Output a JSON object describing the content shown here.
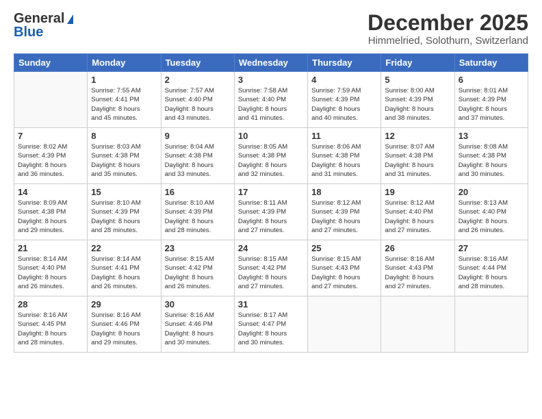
{
  "logo": {
    "line1": "General",
    "line2": "Blue"
  },
  "title": "December 2025",
  "location": "Himmelried, Solothurn, Switzerland",
  "days_of_week": [
    "Sunday",
    "Monday",
    "Tuesday",
    "Wednesday",
    "Thursday",
    "Friday",
    "Saturday"
  ],
  "weeks": [
    [
      {
        "day": "",
        "info": ""
      },
      {
        "day": "1",
        "info": "Sunrise: 7:55 AM\nSunset: 4:41 PM\nDaylight: 8 hours\nand 45 minutes."
      },
      {
        "day": "2",
        "info": "Sunrise: 7:57 AM\nSunset: 4:40 PM\nDaylight: 8 hours\nand 43 minutes."
      },
      {
        "day": "3",
        "info": "Sunrise: 7:58 AM\nSunset: 4:40 PM\nDaylight: 8 hours\nand 41 minutes."
      },
      {
        "day": "4",
        "info": "Sunrise: 7:59 AM\nSunset: 4:39 PM\nDaylight: 8 hours\nand 40 minutes."
      },
      {
        "day": "5",
        "info": "Sunrise: 8:00 AM\nSunset: 4:39 PM\nDaylight: 8 hours\nand 38 minutes."
      },
      {
        "day": "6",
        "info": "Sunrise: 8:01 AM\nSunset: 4:39 PM\nDaylight: 8 hours\nand 37 minutes."
      }
    ],
    [
      {
        "day": "7",
        "info": "Sunrise: 8:02 AM\nSunset: 4:39 PM\nDaylight: 8 hours\nand 36 minutes."
      },
      {
        "day": "8",
        "info": "Sunrise: 8:03 AM\nSunset: 4:38 PM\nDaylight: 8 hours\nand 35 minutes."
      },
      {
        "day": "9",
        "info": "Sunrise: 8:04 AM\nSunset: 4:38 PM\nDaylight: 8 hours\nand 33 minutes."
      },
      {
        "day": "10",
        "info": "Sunrise: 8:05 AM\nSunset: 4:38 PM\nDaylight: 8 hours\nand 32 minutes."
      },
      {
        "day": "11",
        "info": "Sunrise: 8:06 AM\nSunset: 4:38 PM\nDaylight: 8 hours\nand 31 minutes."
      },
      {
        "day": "12",
        "info": "Sunrise: 8:07 AM\nSunset: 4:38 PM\nDaylight: 8 hours\nand 31 minutes."
      },
      {
        "day": "13",
        "info": "Sunrise: 8:08 AM\nSunset: 4:38 PM\nDaylight: 8 hours\nand 30 minutes."
      }
    ],
    [
      {
        "day": "14",
        "info": "Sunrise: 8:09 AM\nSunset: 4:38 PM\nDaylight: 8 hours\nand 29 minutes."
      },
      {
        "day": "15",
        "info": "Sunrise: 8:10 AM\nSunset: 4:39 PM\nDaylight: 8 hours\nand 28 minutes."
      },
      {
        "day": "16",
        "info": "Sunrise: 8:10 AM\nSunset: 4:39 PM\nDaylight: 8 hours\nand 28 minutes."
      },
      {
        "day": "17",
        "info": "Sunrise: 8:11 AM\nSunset: 4:39 PM\nDaylight: 8 hours\nand 27 minutes."
      },
      {
        "day": "18",
        "info": "Sunrise: 8:12 AM\nSunset: 4:39 PM\nDaylight: 8 hours\nand 27 minutes."
      },
      {
        "day": "19",
        "info": "Sunrise: 8:12 AM\nSunset: 4:40 PM\nDaylight: 8 hours\nand 27 minutes."
      },
      {
        "day": "20",
        "info": "Sunrise: 8:13 AM\nSunset: 4:40 PM\nDaylight: 8 hours\nand 26 minutes."
      }
    ],
    [
      {
        "day": "21",
        "info": "Sunrise: 8:14 AM\nSunset: 4:40 PM\nDaylight: 8 hours\nand 26 minutes."
      },
      {
        "day": "22",
        "info": "Sunrise: 8:14 AM\nSunset: 4:41 PM\nDaylight: 8 hours\nand 26 minutes."
      },
      {
        "day": "23",
        "info": "Sunrise: 8:15 AM\nSunset: 4:42 PM\nDaylight: 8 hours\nand 26 minutes."
      },
      {
        "day": "24",
        "info": "Sunrise: 8:15 AM\nSunset: 4:42 PM\nDaylight: 8 hours\nand 27 minutes."
      },
      {
        "day": "25",
        "info": "Sunrise: 8:15 AM\nSunset: 4:43 PM\nDaylight: 8 hours\nand 27 minutes."
      },
      {
        "day": "26",
        "info": "Sunrise: 8:16 AM\nSunset: 4:43 PM\nDaylight: 8 hours\nand 27 minutes."
      },
      {
        "day": "27",
        "info": "Sunrise: 8:16 AM\nSunset: 4:44 PM\nDaylight: 8 hours\nand 28 minutes."
      }
    ],
    [
      {
        "day": "28",
        "info": "Sunrise: 8:16 AM\nSunset: 4:45 PM\nDaylight: 8 hours\nand 28 minutes."
      },
      {
        "day": "29",
        "info": "Sunrise: 8:16 AM\nSunset: 4:46 PM\nDaylight: 8 hours\nand 29 minutes."
      },
      {
        "day": "30",
        "info": "Sunrise: 8:16 AM\nSunset: 4:46 PM\nDaylight: 8 hours\nand 30 minutes."
      },
      {
        "day": "31",
        "info": "Sunrise: 8:17 AM\nSunset: 4:47 PM\nDaylight: 8 hours\nand 30 minutes."
      },
      {
        "day": "",
        "info": ""
      },
      {
        "day": "",
        "info": ""
      },
      {
        "day": "",
        "info": ""
      }
    ]
  ]
}
